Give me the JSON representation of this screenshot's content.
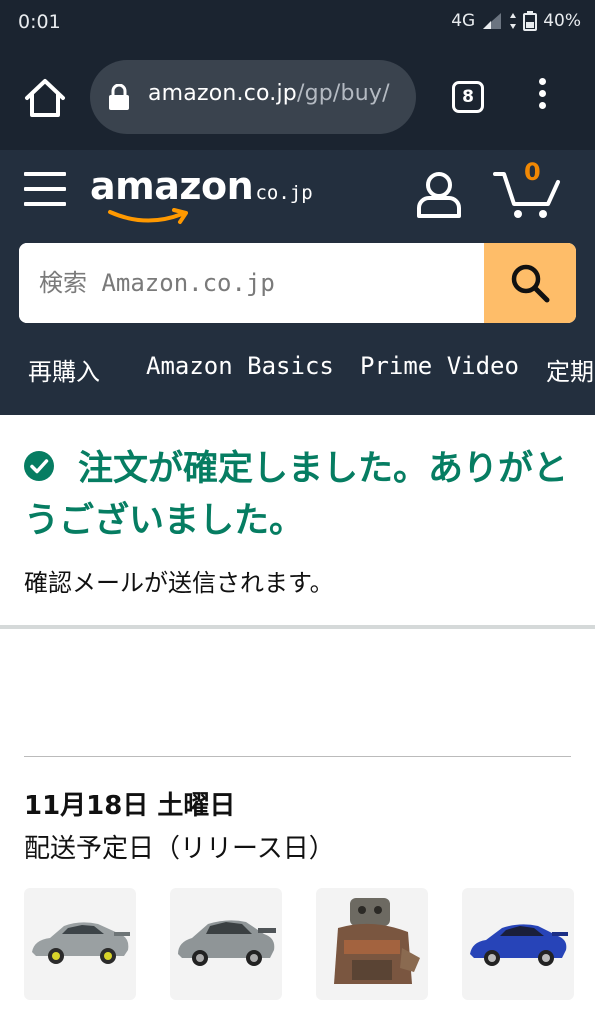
{
  "status_bar": {
    "time": "0:01",
    "network": "4G",
    "battery": "40%"
  },
  "browser": {
    "url_domain": "amazon.co.jp",
    "url_path": "/gp/buy/",
    "tab_count": "8"
  },
  "header": {
    "logo_text": "amazon",
    "logo_tld": ".co.jp",
    "cart_count": "0",
    "search_placeholder": "検索 Amazon.co.jp"
  },
  "nav": {
    "items": [
      {
        "label": "再購入"
      },
      {
        "label": "Amazon Basics"
      },
      {
        "label": "Prime Video"
      },
      {
        "label": "定期"
      }
    ]
  },
  "confirmation": {
    "title": "注文が確定しました。ありがとうございました。",
    "subtitle": "確認メールが送信されます。"
  },
  "delivery": {
    "date": "11月18日 土曜日",
    "label": "配送予定日（リリース日）"
  },
  "products": [
    {
      "name": "silver-sports-car"
    },
    {
      "name": "gray-sedan"
    },
    {
      "name": "castle-figure"
    },
    {
      "name": "blue-sports-car"
    }
  ],
  "colors": {
    "header_bg": "#232f3e",
    "browser_bg": "#1b2430",
    "search_button": "#febd69",
    "success_green": "#067d62",
    "cart_badge": "#f08804"
  }
}
